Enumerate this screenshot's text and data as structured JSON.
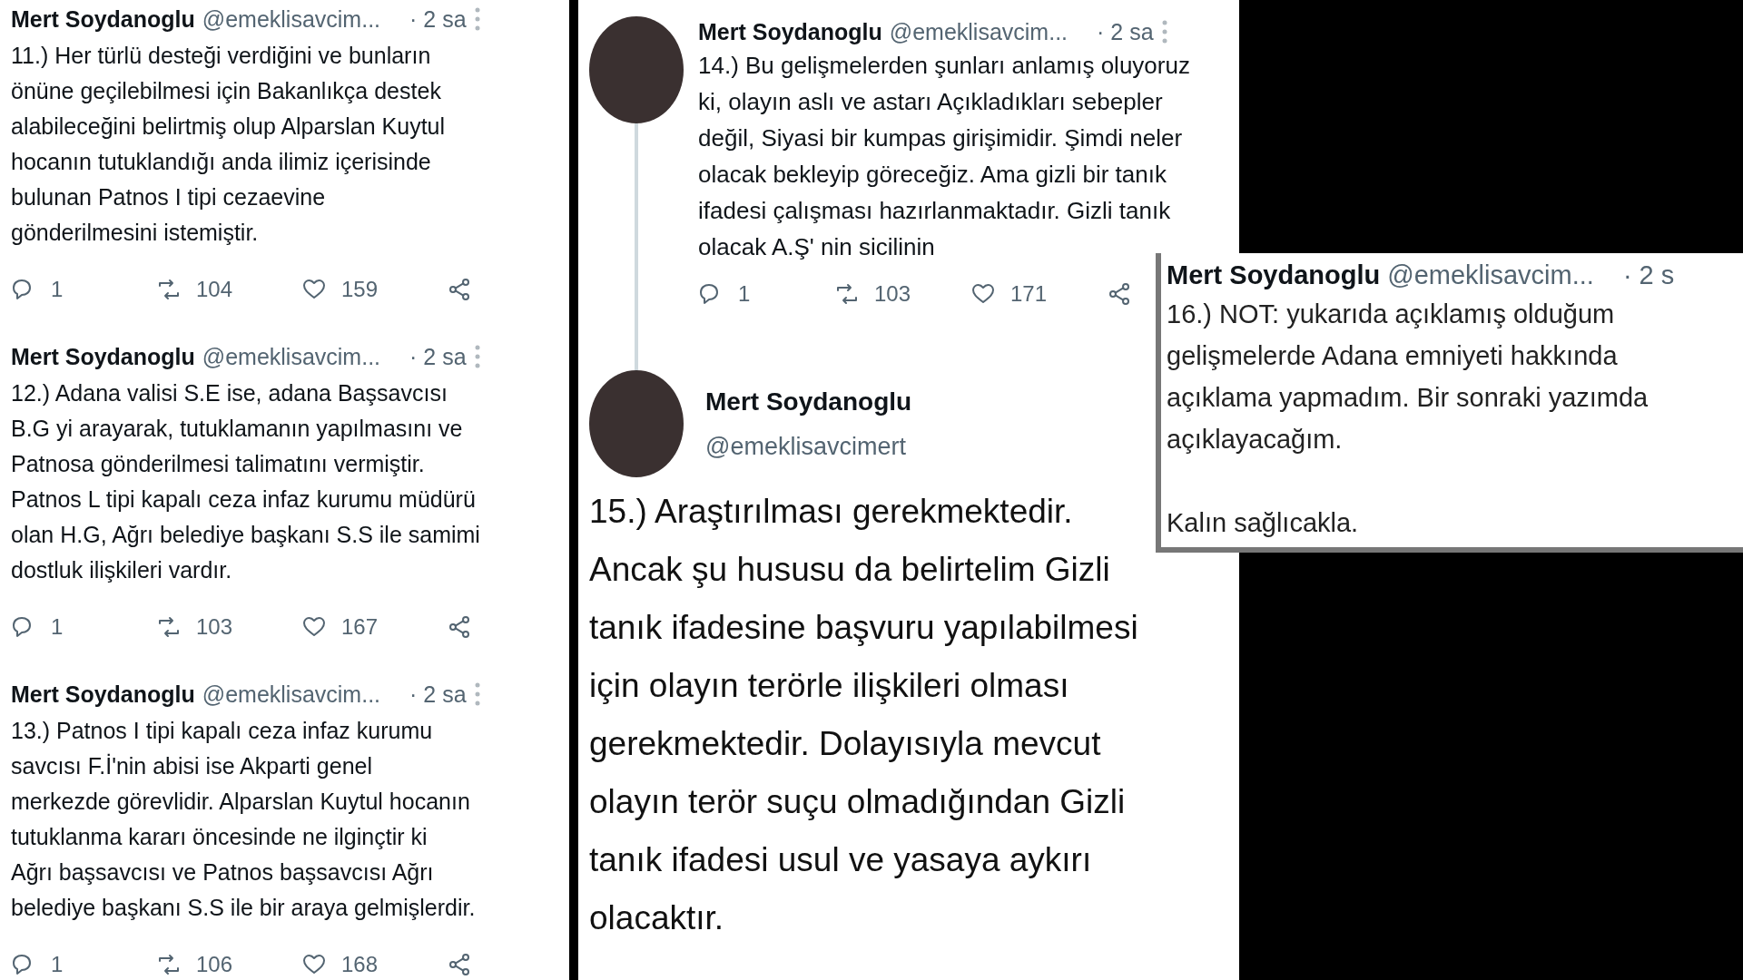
{
  "left_column": {
    "tweets": [
      {
        "author": "Mert Soydanoglu",
        "handle": "@emeklisavcim...",
        "time": "· 2 sa",
        "text": "11.) Her türlü desteği verdiğini ve bunların\nönüne geçilebilmesi için Bakanlıkça destek\nalabileceğini belirtmiş olup Alparslan Kuytul\nhocanın tutuklandığı anda ilimiz içerisinde\nbulunan Patnos I tipi cezaevine\ngönderilmesini istemiştir.",
        "replies": "1",
        "retweets": "104",
        "likes": "159"
      },
      {
        "author": "Mert Soydanoglu",
        "handle": "@emeklisavcim...",
        "time": "· 2 sa",
        "text": "12.) Adana valisi S.E ise, adana Başsavcısı\nB.G yi arayarak, tutuklamanın yapılmasını ve\nPatnosa gönderilmesi talimatını vermiştir.\nPatnos L tipi kapalı ceza infaz kurumu müdürü\nolan H.G, Ağrı belediye başkanı S.S ile samimi\ndostluk ilişkileri vardır.",
        "replies": "1",
        "retweets": "103",
        "likes": "167"
      },
      {
        "author": "Mert Soydanoglu",
        "handle": "@emeklisavcim...",
        "time": "· 2 sa",
        "text": "13.) Patnos I tipi kapalı ceza infaz kurumu\nsavcısı F.İ'nin abisi ise Akparti genel\nmerkezde görevlidir. Alparslan Kuytul hocanın\ntutuklanma kararı öncesinde ne ilginçtir ki\nAğrı başsavcısı ve Patnos başsavcısı Ağrı\nbelediye başkanı S.S ile bir araya gelmişlerdir.",
        "replies": "1",
        "retweets": "106",
        "likes": "168"
      }
    ]
  },
  "middle_column": {
    "thread_tweet": {
      "author": "Mert Soydanoglu",
      "handle": "@emeklisavcim...",
      "time": "· 2 sa",
      "text": "14.) Bu gelişmelerden şunları anlamış oluyoruz\nki, olayın aslı ve astarı Açıkladıkları sebepler\ndeğil, Siyasi bir kumpas girişimidir. Şimdi neler\nolacak bekleyip göreceğiz. Ama gizli bir tanık\nifadesi çalışması hazırlanmaktadır. Gizli tanık\nolacak A.Ş' nin sicilinin",
      "replies": "1",
      "retweets": "103",
      "likes": "171"
    },
    "main_tweet": {
      "author": "Mert Soydanoglu",
      "handle": "@emeklisavcimert",
      "text": "15.) Araştırılması gerekmektedir.\nAncak şu hususu da belirtelim Gizli\ntanık ifadesine başvuru yapılabilmesi\niçin olayın terörle ilişkileri olması\ngerekmektedir. Dolayısıyla mevcut\nolayın terör suçu olmadığından Gizli\ntanık ifadesi usul ve yasaya aykırı\nolacaktır."
    }
  },
  "overlay_tweet": {
    "author": "Mert Soydanoglu",
    "handle": "@emeklisavcim...",
    "time": "· 2 s",
    "text": "16.) NOT: yukarıda açıklamış olduğum\ngelişmelerde Adana emniyeti hakkında\naçıklama yapmadım. Bir sonraki yazımda\naçıklayacağım.\n\nKalın sağlıcakla."
  }
}
